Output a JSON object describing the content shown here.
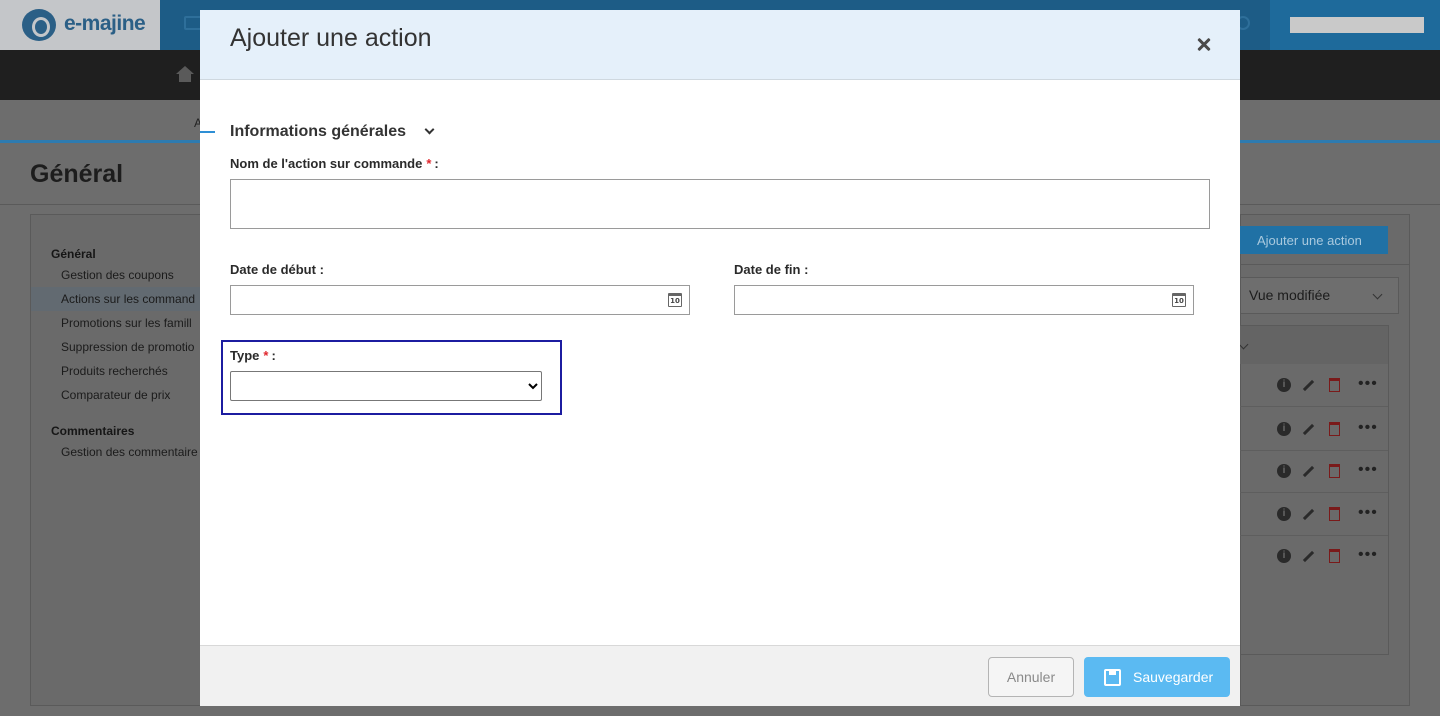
{
  "app": {
    "logo_text": "e-majine",
    "subnav_text": "A",
    "page_title": "Général"
  },
  "sidebar": {
    "sections": [
      {
        "title": "Général",
        "items": [
          "Gestion des coupons",
          "Actions sur les command",
          "Promotions sur les famill",
          "Suppression de promotio",
          "Produits recherchés",
          "Comparateur de prix"
        ]
      },
      {
        "title": "Commentaires",
        "items": [
          "Gestion des commentaire"
        ]
      }
    ]
  },
  "right_panel": {
    "add_button_label": "Ajouter une action",
    "view_select_value": "Vue modifiée",
    "row_icons": [
      "info-icon",
      "edit-icon",
      "trash-icon",
      "more-icon"
    ],
    "more_glyph": "•••"
  },
  "modal": {
    "title": "Ajouter une action",
    "section_title": "Informations générales",
    "fields": {
      "name": {
        "label": "Nom de l'action sur commande",
        "required_mark": "*",
        "suffix": ":",
        "value": ""
      },
      "start_date": {
        "label": "Date de début :",
        "value": ""
      },
      "end_date": {
        "label": "Date de fin :",
        "value": ""
      },
      "type": {
        "label": "Type",
        "required_mark": "*",
        "suffix": ":",
        "selected": ""
      }
    },
    "calendar_icon_text": "10",
    "footer": {
      "cancel_label": "Annuler",
      "save_label": "Sauvegarder"
    }
  },
  "colors": {
    "accent_blue": "#5bbaf2",
    "header_bg": "#e5f0fa",
    "required_red": "#e0262d",
    "focus_outline": "#1c1ca0"
  }
}
